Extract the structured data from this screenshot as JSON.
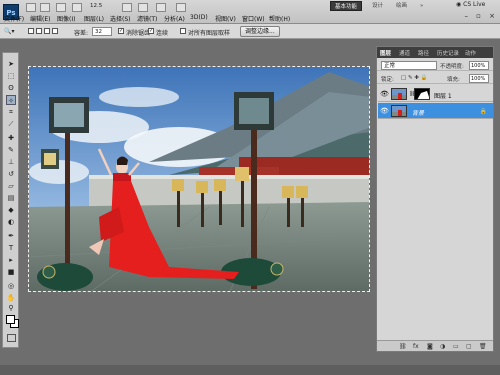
{
  "app": {
    "logo": "Ps",
    "zoom": "12.5"
  },
  "menu": [
    "文件(F)",
    "编辑(E)",
    "图像(I)",
    "图层(L)",
    "选择(S)",
    "滤镜(T)",
    "分析(A)",
    "3D(D)",
    "视图(V)",
    "窗口(W)",
    "帮助(H)"
  ],
  "workspace": {
    "active": "基本功能",
    "others": [
      "设计",
      "绘画",
      "»"
    ],
    "cslive": "CS Live"
  },
  "options": {
    "tolerance_label": "容差:",
    "tolerance_value": "32",
    "antialias_label": "消除锯齿",
    "contiguous_label": "连续",
    "sample_all_label": "对所有图层取样",
    "refine_button": "调整边缘..."
  },
  "layers_panel": {
    "tabs": [
      "图层",
      "通道",
      "路径",
      "历史记录",
      "动作"
    ],
    "blend_mode": "正常",
    "opacity_label": "不透明度:",
    "opacity_value": "100%",
    "lock_label": "锁定:",
    "fill_label": "填充:",
    "fill_value": "100%",
    "layers": [
      {
        "name": "图层 1",
        "selected": false
      },
      {
        "name": "背景",
        "selected": true
      }
    ],
    "bottom_icons": [
      "link-icon",
      "fx-icon",
      "mask-icon",
      "adjust-icon",
      "folder-icon",
      "new-layer-icon",
      "trash-icon"
    ]
  },
  "colors": {
    "selection_highlight": "#3d8fe0",
    "active_workspace": "#3b3b3b"
  }
}
